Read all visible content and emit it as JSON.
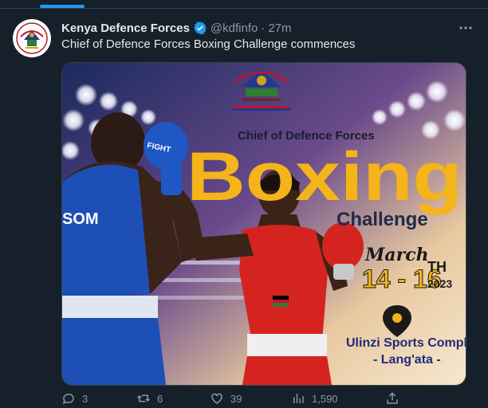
{
  "tweet": {
    "author_name": "Kenya Defence Forces",
    "handle": "@kdfinfo",
    "separator": "·",
    "time": "27m",
    "more_icon": "ellipsis-icon",
    "verified_icon": "verified-badge-icon",
    "text": "Chief of Defence Forces Boxing Challenge commences"
  },
  "poster": {
    "pre_title": "Chief of Defence Forces",
    "title": "Boxing",
    "subtitle": "Challenge",
    "month": "March",
    "dates": "14 - 16",
    "date_suffix": "TH",
    "year": "2023",
    "venue_line1": "Ulinzi Sports Complex",
    "venue_line2": "- Lang'ata -",
    "shorts_text": "SOM",
    "glove_text": "FIGHT",
    "accent_color": "#f4b41a",
    "venue_color": "#1f2a7a"
  },
  "actions": {
    "reply_count": "3",
    "retweet_count": "6",
    "like_count": "39",
    "views_count": "1,590"
  },
  "colors": {
    "background": "#15202b",
    "text": "#e7e9ea",
    "muted": "#8b98a5",
    "accent": "#1d9bf0"
  }
}
